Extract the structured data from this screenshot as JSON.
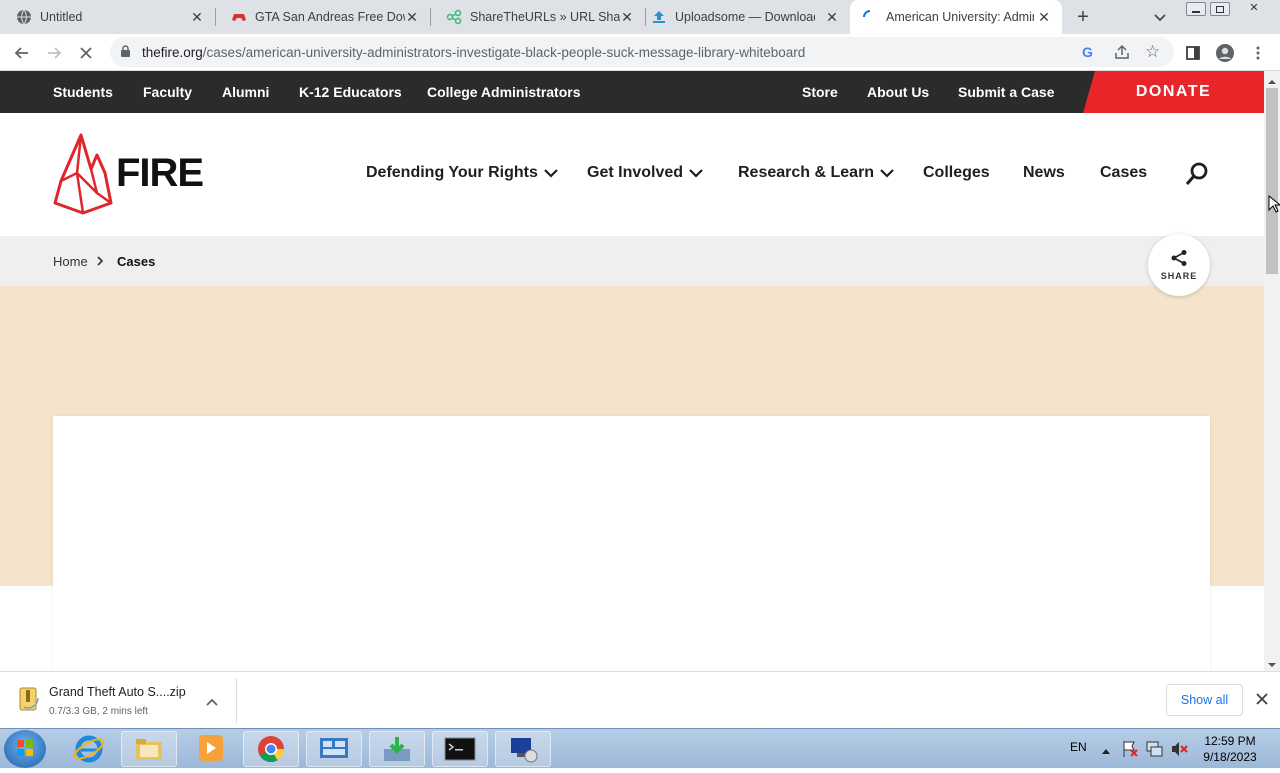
{
  "browser": {
    "tabs": [
      {
        "title": "Untitled",
        "icon": "globe-icon"
      },
      {
        "title": "GTA San Andreas Free Down",
        "icon": "gamepad-icon"
      },
      {
        "title": "ShareTheURLs » URL Sharin",
        "icon": "share-nodes-icon"
      },
      {
        "title": "Uploadsome — Download",
        "icon": "upload-icon"
      },
      {
        "title": "American University: Admin",
        "icon": "loading-spinner-icon"
      }
    ],
    "url_domain": "thefire.org",
    "url_path": "/cases/american-university-administrators-investigate-black-people-suck-message-library-whiteboard"
  },
  "site": {
    "topbar_left": [
      "Students",
      "Faculty",
      "Alumni",
      "K-12 Educators",
      "College Administrators"
    ],
    "topbar_right": [
      "Store",
      "About Us",
      "Submit a Case"
    ],
    "donate": "DONATE",
    "logo_text": "FIRE",
    "nav": [
      "Defending Your Rights",
      "Get Involved",
      "Research & Learn",
      "Colleges",
      "News",
      "Cases"
    ],
    "breadcrumb": {
      "home": "Home",
      "current": "Cases"
    },
    "share_label": "SHARE"
  },
  "download": {
    "filename": "Grand Theft Auto S....zip",
    "status": "0.7/3.3 GB, 2 mins left",
    "show_all": "Show all"
  },
  "taskbar": {
    "lang": "EN",
    "time": "12:59 PM",
    "date": "9/18/2023"
  },
  "colors": {
    "accent_red": "#e8262a",
    "topbar_bg": "#2b2b2b",
    "hero_bg": "#f3e4cb"
  }
}
